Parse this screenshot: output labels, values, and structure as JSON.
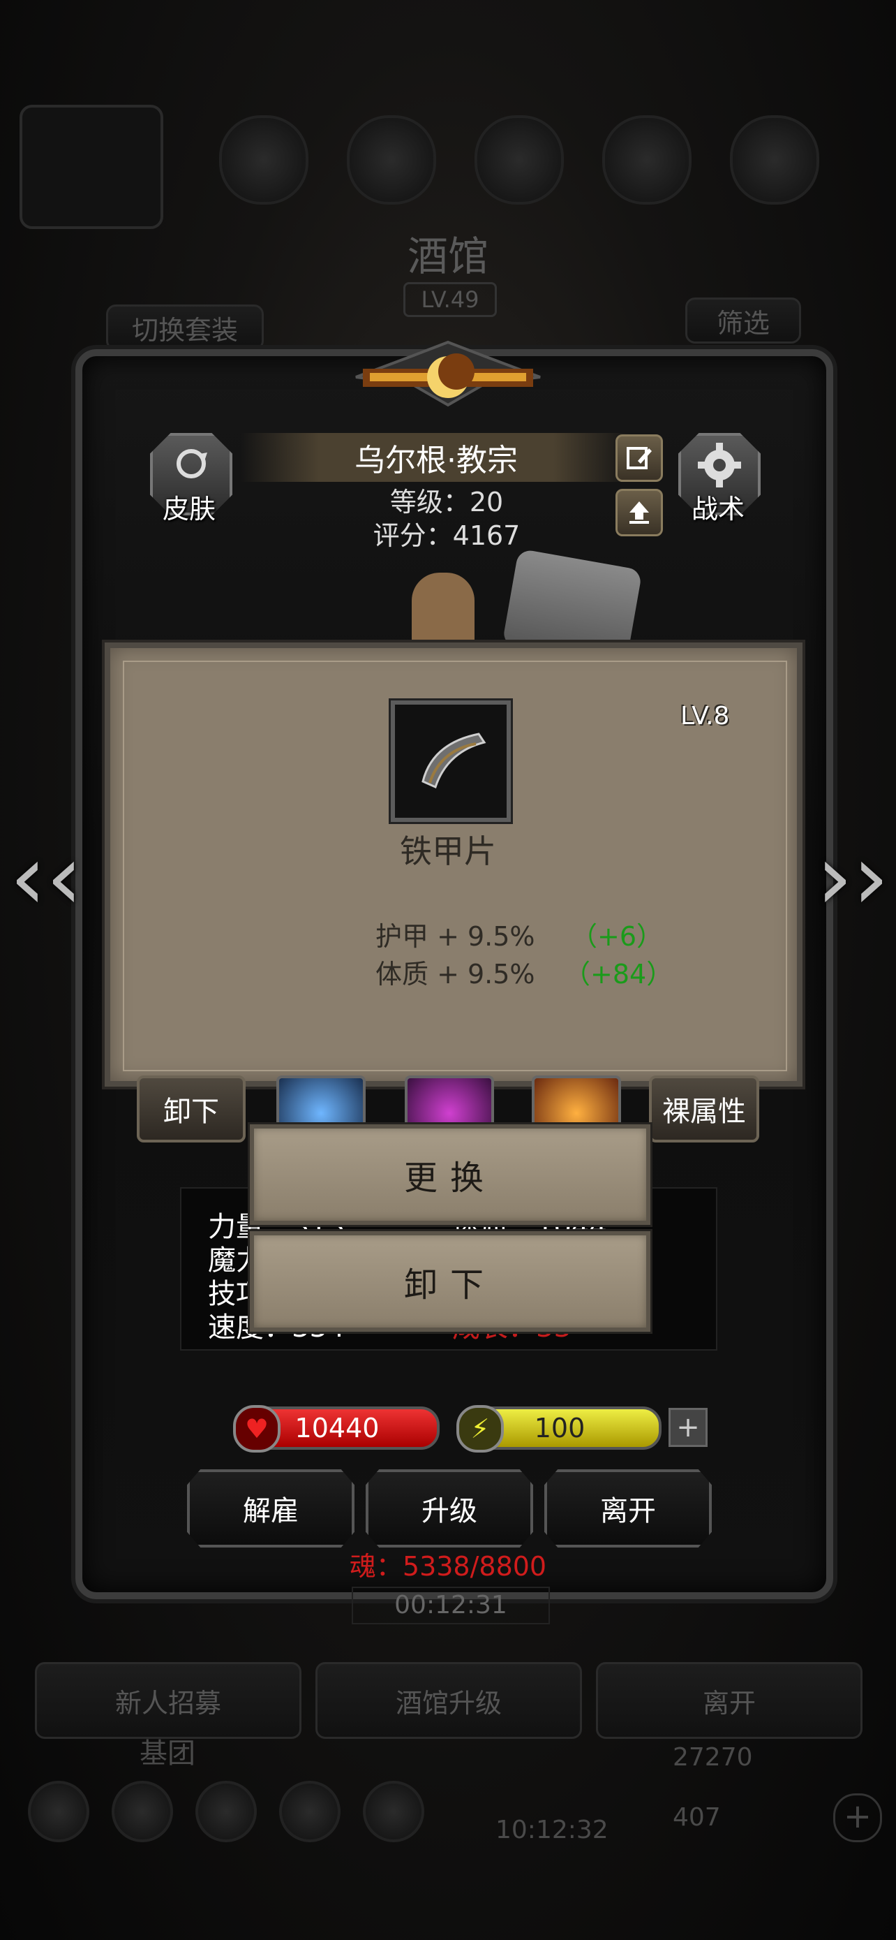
{
  "background": {
    "title": "酒馆",
    "level": "LV.49",
    "switch_outfit": "切换套装",
    "filter": "筛选",
    "timer": "00:12:31",
    "buttons": [
      "新人招募",
      "酒馆升级",
      "离开"
    ],
    "group_label": "基团",
    "clock": "10:12:32",
    "gold": "27270",
    "gems": "407"
  },
  "hero": {
    "name": "乌尔根·教宗",
    "level_line": "等级：20",
    "score_line": "评分：4167",
    "skin_label": "皮肤",
    "tactics_label": "战术",
    "edit_icon": "edit-icon",
    "upload_icon": "upload-icon"
  },
  "item_card": {
    "level": "LV.8",
    "name": "铁甲片",
    "icon": "armor-plate-icon",
    "attributes": [
      {
        "label": "护甲 + 9.5%",
        "bonus": "（+6）"
      },
      {
        "label": "体质 + 9.5%",
        "bonus": "（+84）"
      }
    ]
  },
  "equip_row": {
    "unequip_label": "卸下",
    "bare_attr_label": "裸属性"
  },
  "popup_menu": {
    "replace": "更换",
    "unequip": "卸下"
  },
  "stats": {
    "rows": [
      {
        "left": "力量：313",
        "right": "体质：1044"
      },
      {
        "left": "魔力",
        "right": ""
      },
      {
        "left": "技巧",
        "right": ""
      },
      {
        "left": "速度：334",
        "right": "成长：33"
      }
    ]
  },
  "bars": {
    "hp": "10440",
    "energy": "100",
    "plus": "+"
  },
  "actions": {
    "dismiss": "解雇",
    "upgrade": "升级",
    "leave": "离开"
  },
  "soul": "魂：5338/8800",
  "colors": {
    "accent_gold": "#e0a030",
    "bonus_green": "#1a9b1a",
    "soul_red": "#d01c1c",
    "hp_red": "#c81818",
    "energy_yellow": "#d8c818"
  }
}
